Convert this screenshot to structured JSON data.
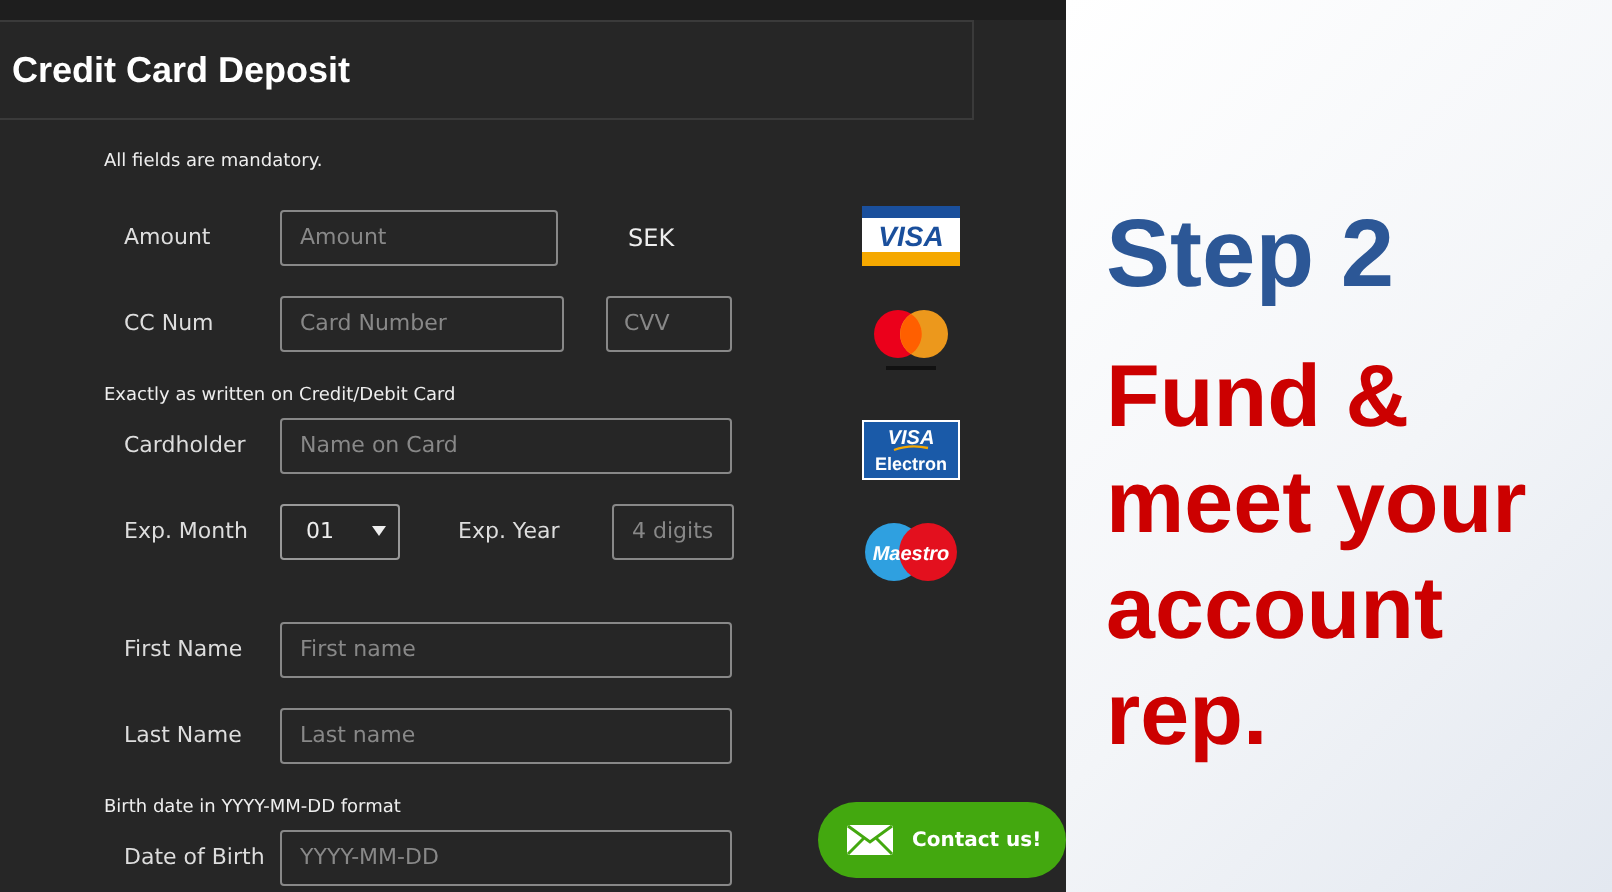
{
  "header": {
    "title": "Credit Card Deposit"
  },
  "form": {
    "rows": [
      {
        "kind": "note",
        "text": "All fields are mandatory."
      },
      {
        "kind": "amount",
        "label": "Amount",
        "placeholder": "Amount",
        "unit": "SEK"
      },
      {
        "kind": "card",
        "label": "CC Num",
        "placeholder": "Card Number",
        "cvv_placeholder": "CVV"
      },
      {
        "kind": "note",
        "text": "Exactly as written on Credit/Debit Card"
      },
      {
        "kind": "text",
        "label": "Cardholder",
        "placeholder": "Name on Card"
      },
      {
        "kind": "expiry",
        "label": "Exp. Month",
        "month": "01",
        "year_label": "Exp. Year",
        "year_placeholder": "4 digits"
      },
      {
        "kind": "text",
        "label": "First Name",
        "placeholder": "First name"
      },
      {
        "kind": "text",
        "label": "Last Name",
        "placeholder": "Last name"
      },
      {
        "kind": "note",
        "text": "Birth date in YYYY-MM-DD format"
      },
      {
        "kind": "text",
        "label": "Date of Birth",
        "placeholder": "YYYY-MM-DD"
      }
    ]
  },
  "card_logos": [
    {
      "kind": "visa",
      "text": "VISA"
    },
    {
      "kind": "mastercard"
    },
    {
      "kind": "visa_electron",
      "text": "VISA",
      "subtext": "Electron"
    },
    {
      "kind": "maestro",
      "text": "Maestro"
    }
  ],
  "contact_button": {
    "label": "Contact us!"
  },
  "promo": {
    "title": "Step 2",
    "subtitle": "Fund & meet your account rep."
  }
}
